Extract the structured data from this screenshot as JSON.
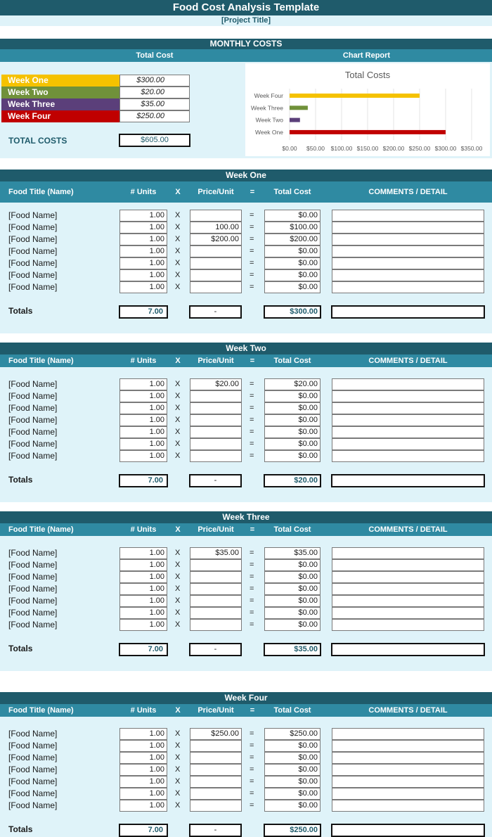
{
  "header": {
    "title": "Food Cost Analysis Template",
    "project_title": "[Project Title]"
  },
  "monthly": {
    "heading": "MONTHLY COSTS",
    "total_cost_label": "Total Cost",
    "chart_report_label": "Chart Report",
    "weeks": [
      {
        "label": "Week One",
        "value": "$300.00",
        "color": "#f5c200"
      },
      {
        "label": "Week Two",
        "value": "$20.00",
        "color": "#70913a"
      },
      {
        "label": "Week Three",
        "value": "$35.00",
        "color": "#5b3f7a"
      },
      {
        "label": "Week Four",
        "value": "$250.00",
        "color": "#c00000"
      }
    ],
    "total_costs_label": "TOTAL COSTS",
    "total_costs_value": "$605.00"
  },
  "chart_data": {
    "type": "bar",
    "orientation": "horizontal",
    "title": "Total Costs",
    "categories": [
      "Week Four",
      "Week Three",
      "Week Two",
      "Week One"
    ],
    "values": [
      250,
      35,
      20,
      300
    ],
    "colors": [
      "#f5c200",
      "#70913a",
      "#5b3f7a",
      "#c00000"
    ],
    "xlim": [
      0,
      350
    ],
    "ticks": [
      "$0.00",
      "$50.00",
      "$100.00",
      "$150.00",
      "$200.00",
      "$250.00",
      "$300.00",
      "$350.00"
    ],
    "grid": true
  },
  "columns": {
    "food": "Food Title (Name)",
    "units": "# Units",
    "x": "X",
    "price": "Price/Unit",
    "eq": "=",
    "total": "Total Cost",
    "comments": "COMMENTS / DETAIL"
  },
  "totals_label": "Totals",
  "sections": [
    {
      "title": "Week One",
      "rows": [
        {
          "name": "[Food Name]",
          "units": "1.00",
          "price": "",
          "total": "$0.00"
        },
        {
          "name": "[Food Name]",
          "units": "1.00",
          "price": "100.00",
          "total": "$100.00"
        },
        {
          "name": "[Food Name]",
          "units": "1.00",
          "price": "$200.00",
          "total": "$200.00"
        },
        {
          "name": "[Food Name]",
          "units": "1.00",
          "price": "",
          "total": "$0.00"
        },
        {
          "name": "[Food Name]",
          "units": "1.00",
          "price": "",
          "total": "$0.00"
        },
        {
          "name": "[Food Name]",
          "units": "1.00",
          "price": "",
          "total": "$0.00"
        },
        {
          "name": "[Food Name]",
          "units": "1.00",
          "price": "",
          "total": "$0.00"
        }
      ],
      "totals": {
        "units": "7.00",
        "price": "-",
        "total": "$300.00"
      }
    },
    {
      "title": "Week Two",
      "rows": [
        {
          "name": "[Food Name]",
          "units": "1.00",
          "price": "$20.00",
          "total": "$20.00"
        },
        {
          "name": "[Food Name]",
          "units": "1.00",
          "price": "",
          "total": "$0.00"
        },
        {
          "name": "[Food Name]",
          "units": "1.00",
          "price": "",
          "total": "$0.00"
        },
        {
          "name": "[Food Name]",
          "units": "1.00",
          "price": "",
          "total": "$0.00"
        },
        {
          "name": "[Food Name]",
          "units": "1.00",
          "price": "",
          "total": "$0.00"
        },
        {
          "name": "[Food Name]",
          "units": "1.00",
          "price": "",
          "total": "$0.00"
        },
        {
          "name": "[Food Name]",
          "units": "1.00",
          "price": "",
          "total": "$0.00"
        }
      ],
      "totals": {
        "units": "7.00",
        "price": "-",
        "total": "$20.00"
      }
    },
    {
      "title": "Week Three",
      "rows": [
        {
          "name": "[Food Name]",
          "units": "1.00",
          "price": "$35.00",
          "total": "$35.00"
        },
        {
          "name": "[Food Name]",
          "units": "1.00",
          "price": "",
          "total": "$0.00"
        },
        {
          "name": "[Food Name]",
          "units": "1.00",
          "price": "",
          "total": "$0.00"
        },
        {
          "name": "[Food Name]",
          "units": "1.00",
          "price": "",
          "total": "$0.00"
        },
        {
          "name": "[Food Name]",
          "units": "1.00",
          "price": "",
          "total": "$0.00"
        },
        {
          "name": "[Food Name]",
          "units": "1.00",
          "price": "",
          "total": "$0.00"
        },
        {
          "name": "[Food Name]",
          "units": "1.00",
          "price": "",
          "total": "$0.00"
        }
      ],
      "totals": {
        "units": "7.00",
        "price": "-",
        "total": "$35.00"
      }
    },
    {
      "title": "Week Four",
      "rows": [
        {
          "name": "[Food Name]",
          "units": "1.00",
          "price": "$250.00",
          "total": "$250.00"
        },
        {
          "name": "[Food Name]",
          "units": "1.00",
          "price": "",
          "total": "$0.00"
        },
        {
          "name": "[Food Name]",
          "units": "1.00",
          "price": "",
          "total": "$0.00"
        },
        {
          "name": "[Food Name]",
          "units": "1.00",
          "price": "",
          "total": "$0.00"
        },
        {
          "name": "[Food Name]",
          "units": "1.00",
          "price": "",
          "total": "$0.00"
        },
        {
          "name": "[Food Name]",
          "units": "1.00",
          "price": "",
          "total": "$0.00"
        },
        {
          "name": "[Food Name]",
          "units": "1.00",
          "price": "",
          "total": "$0.00"
        }
      ],
      "totals": {
        "units": "7.00",
        "price": "-",
        "total": "$250.00"
      }
    }
  ]
}
